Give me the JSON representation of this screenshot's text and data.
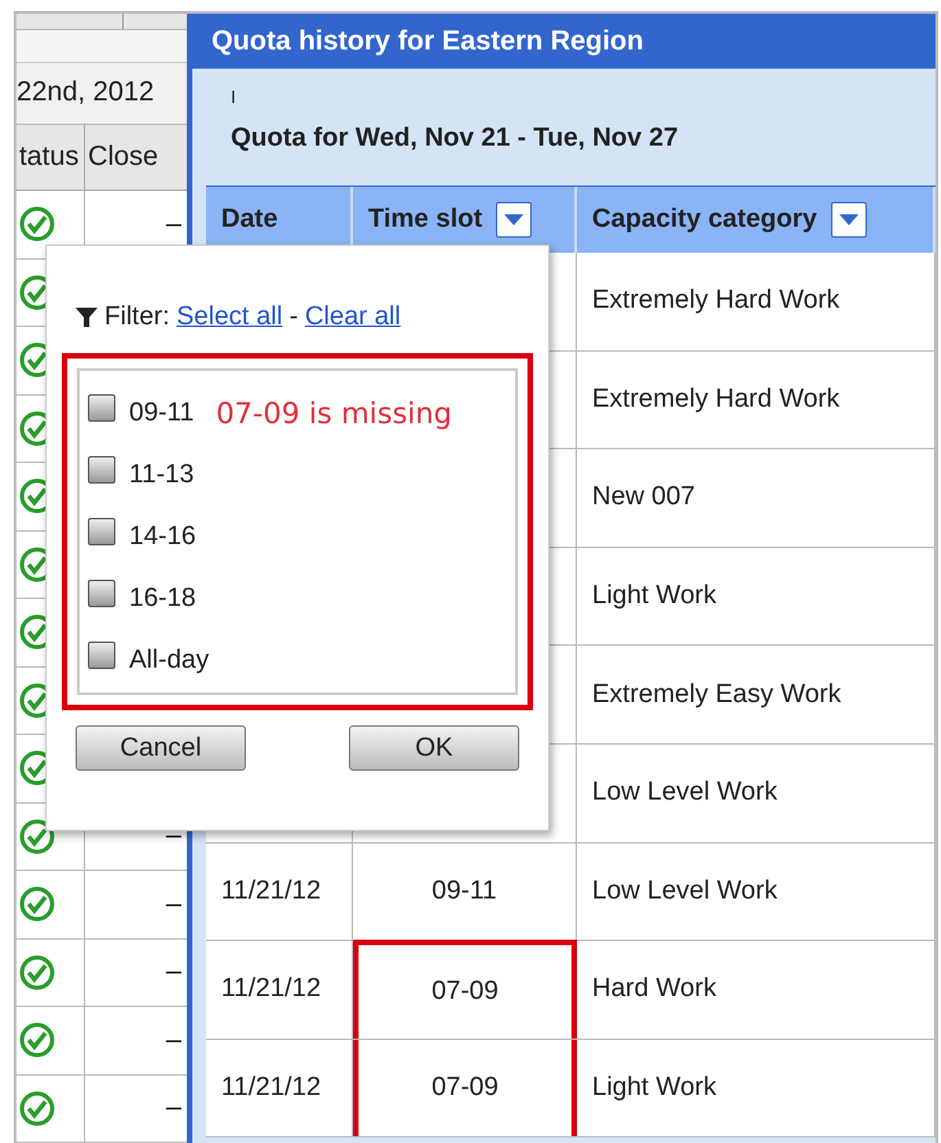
{
  "background_table": {
    "date_text": "22nd, 2012",
    "columns": [
      "tatus",
      "Close"
    ],
    "rows": [
      {
        "kind": "check",
        "close": "–"
      },
      {
        "kind": "check"
      },
      {
        "kind": "check"
      },
      {
        "kind": "check"
      },
      {
        "kind": "check"
      },
      {
        "kind": "check"
      },
      {
        "kind": "check"
      },
      {
        "kind": "check"
      },
      {
        "kind": "check"
      },
      {
        "kind": "check",
        "close": "–"
      },
      {
        "kind": "check",
        "close": "–"
      },
      {
        "kind": "check",
        "close": "–"
      },
      {
        "kind": "check",
        "close": "–"
      },
      {
        "kind": "check",
        "close": "–"
      }
    ]
  },
  "dialog": {
    "title": "Quota history for Eastern Region",
    "cursor": "I",
    "heading": "Quota for Wed, Nov 21 - Tue, Nov 27",
    "table": {
      "columns": [
        {
          "label": "Date",
          "filter": false
        },
        {
          "label": "Time slot",
          "filter": true
        },
        {
          "label": "Capacity category",
          "filter": true
        }
      ],
      "rows": [
        {
          "capacity": "Extremely Hard Work"
        },
        {
          "capacity": "Extremely Hard Work"
        },
        {
          "capacity": "New 007"
        },
        {
          "capacity": "Light Work"
        },
        {
          "capacity": "Extremely Easy Work"
        },
        {
          "capacity": "Low Level Work"
        },
        {
          "date": "11/21/12",
          "time_slot": "09-11",
          "capacity": "Low Level Work",
          "highlighted": false
        },
        {
          "date": "11/21/12",
          "time_slot": "07-09",
          "capacity": "Hard Work",
          "highlighted": true
        },
        {
          "date": "11/21/12",
          "time_slot": "07-09",
          "capacity": "Light Work",
          "highlighted": true
        }
      ]
    }
  },
  "filter_popup": {
    "label": "Filter:",
    "select_all": "Select all",
    "separator": "-",
    "clear_all": "Clear all",
    "annotation": "07-09 is missing",
    "list_highlighted": true,
    "options": [
      {
        "label": "09-11",
        "checked": false
      },
      {
        "label": "11-13",
        "checked": false
      },
      {
        "label": "14-16",
        "checked": false
      },
      {
        "label": "16-18",
        "checked": false
      },
      {
        "label": "All-day",
        "checked": false
      }
    ],
    "buttons": [
      "Cancel",
      "OK"
    ]
  }
}
